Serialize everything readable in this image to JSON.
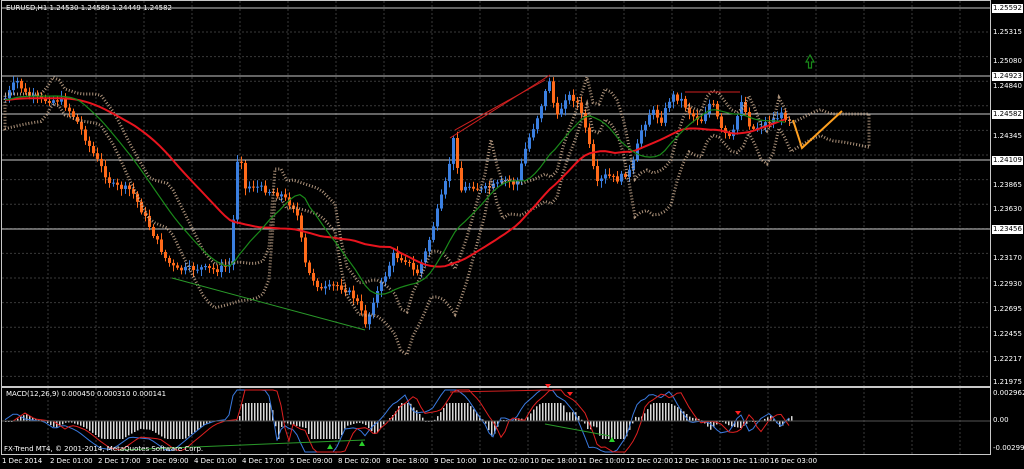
{
  "chart": {
    "symbol_header": "EURUSD,H1  1.24530 1.24589 1.24449 1.24582",
    "indicator_header": "MACD(12,26,9) 0.000450 0.000310 0.000141",
    "copyright": "FX-Trend MT4, © 2001-2014, MetaQuotes Software Corp."
  },
  "price_axis": {
    "ticks": [
      "1.25315",
      "1.25080",
      "1.24840",
      "1.24582",
      "1.24345",
      "1.24109",
      "1.23865",
      "1.23630",
      "1.23393",
      "1.23170",
      "1.22930",
      "1.22695",
      "1.22455",
      "1.22217",
      "1.21975"
    ],
    "tags": [
      "1.25592",
      "1.24923",
      "1.24582",
      "1.24109",
      "1.23456"
    ]
  },
  "macd_axis": {
    "ticks": [
      "0.002962",
      "0.00",
      "-0.002992"
    ]
  },
  "time_axis": {
    "ticks": [
      "1 Dec 2014",
      "2 Dec 01:00",
      "2 Dec 17:00",
      "3 Dec 09:00",
      "4 Dec 01:00",
      "4 Dec 17:00",
      "5 Dec 09:00",
      "8 Dec 02:00",
      "8 Dec 18:00",
      "9 Dec 10:00",
      "10 Dec 02:00",
      "10 Dec 18:00",
      "11 Dec 10:00",
      "12 Dec 02:00",
      "12 Dec 18:00",
      "15 Dec 11:00",
      "16 Dec 03:00"
    ]
  },
  "colors": {
    "background": "#000000",
    "grid": "#3a3a3a",
    "bull_candle": "#3b7fe0",
    "bear_candle": "#ff6a1a",
    "ma_slow": "#e8141e",
    "ma_fast": "#1a8a1a",
    "cloud": "#d8b89a",
    "tag_bg": "#ffffff",
    "arrow_up": "#1a8a1a",
    "projection": "#ffa020"
  },
  "icons": {
    "up_arrow": "up-arrow-icon"
  }
}
